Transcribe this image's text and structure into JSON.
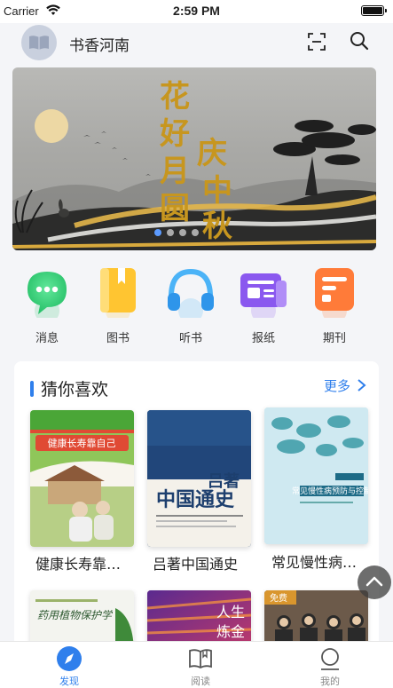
{
  "status_bar": {
    "carrier": "Carrier",
    "time": "2:59 PM"
  },
  "header": {
    "app_title": "书香河南"
  },
  "banner": {
    "text_line1": "花好月圆",
    "text_line2": "庆中秋",
    "slide_count": 4,
    "active_slide": 1
  },
  "categories": [
    {
      "label": "消息",
      "icon": "message-icon",
      "color": "#3ed17a"
    },
    {
      "label": "图书",
      "icon": "book-icon",
      "color": "#ffc531"
    },
    {
      "label": "听书",
      "icon": "headphones-icon",
      "color": "#4bb3f7"
    },
    {
      "label": "报纸",
      "icon": "newspaper-icon",
      "color": "#8a58ef"
    },
    {
      "label": "期刊",
      "icon": "magazine-icon",
      "color": "#ff7b39"
    }
  ],
  "recommend": {
    "title": "猜你喜欢",
    "more_label": "更多",
    "books": [
      {
        "title": "健康长寿靠…",
        "cover_title": "健康长寿靠自己"
      },
      {
        "title": "吕著中国通史",
        "cover_title": "吕著中国通史"
      },
      {
        "title": "常见慢性病…",
        "cover_title": "常见慢性病预防与控制"
      },
      {
        "title": "",
        "cover_title": "药用植物保护学"
      },
      {
        "title": "",
        "cover_title": "人生炼金"
      },
      {
        "title": "",
        "cover_title": "免费"
      }
    ]
  },
  "tabbar": {
    "tabs": [
      {
        "label": "发现",
        "active": true
      },
      {
        "label": "阅读",
        "active": false
      },
      {
        "label": "我的",
        "active": false
      }
    ]
  },
  "colors": {
    "accent": "#2f7fec",
    "background": "#f4f5f8"
  }
}
